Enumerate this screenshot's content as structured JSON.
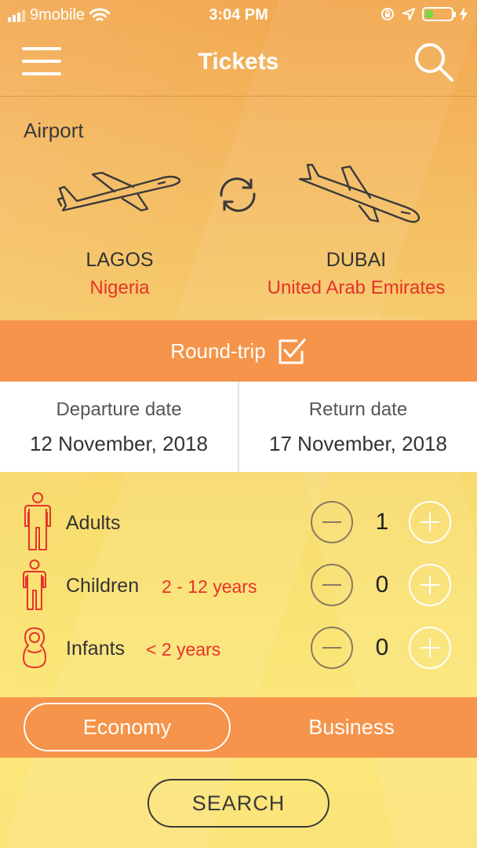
{
  "status_bar": {
    "carrier": "9mobile",
    "time": "3:04 PM",
    "icons": [
      "signal-icon",
      "wifi-icon",
      "orientation-lock-icon",
      "location-icon",
      "battery-icon",
      "charging-icon"
    ]
  },
  "nav": {
    "title": "Tickets",
    "icons": [
      "menu-icon",
      "search-icon"
    ]
  },
  "airport": {
    "label": "Airport",
    "origin": {
      "city": "LAGOS",
      "country": "Nigeria"
    },
    "destination": {
      "city": "DUBAI",
      "country": "United Arab Emirates"
    },
    "icons": [
      "departure-plane-icon",
      "swap-icon",
      "arrival-plane-icon"
    ]
  },
  "trip": {
    "label": "Round-trip",
    "checked": true
  },
  "dates": {
    "departure": {
      "label": "Departure date",
      "value": "12 November, 2018"
    },
    "return": {
      "label": "Return date",
      "value": "17 November, 2018"
    }
  },
  "passengers": [
    {
      "label": "Adults",
      "note": "",
      "count": "1",
      "icon": "adult-icon"
    },
    {
      "label": "Children",
      "note": "2 - 12 years",
      "count": "0",
      "icon": "child-icon"
    },
    {
      "label": "Infants",
      "note": "< 2 years",
      "count": "0",
      "icon": "infant-icon"
    }
  ],
  "travel_class": {
    "options": [
      "Economy",
      "Business"
    ],
    "selected": "Economy"
  },
  "search_button": "SEARCH",
  "colors": {
    "accent": "#f5944a",
    "red": "#e8322a",
    "white": "#ffffff"
  }
}
